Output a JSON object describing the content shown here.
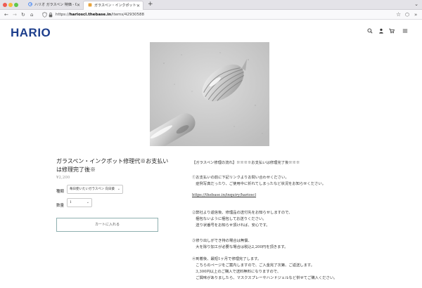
{
  "browser": {
    "tabs": [
      {
        "label": "ハリオ ガラスペン 特価 - Google",
        "active": false
      },
      {
        "label": "ガラスペン・インクポット修理代",
        "active": true
      }
    ],
    "new_tab_icon": "plus-icon",
    "url_host": "harioscl.thebase.in",
    "url_prefix": "https://",
    "url_path": "/items/42930588"
  },
  "site": {
    "logo": "HARIO",
    "brand_color": "#1d3e8c",
    "header_icons": [
      "search-icon",
      "user-icon",
      "cart-icon",
      "menu-icon"
    ]
  },
  "product": {
    "title": "ガラスペン・インクポット修理代※お支払いは修理完了後※",
    "price": "¥2,200",
    "options": [
      {
        "label": "種類",
        "value": "毎日使いたいガラスペン 向日葵"
      },
      {
        "label": "数量",
        "value": "1"
      }
    ],
    "cart_button": "カートに入れる"
  },
  "description": {
    "heading": "【ガラスペン修理の流れ】※※※※お支払いは修理完了後※※※",
    "step1": [
      "①お支払いの前に下記リンクよりお問い合わせください。",
      "　症例写真だったり、ご使用中に折れてしまったなど状況をお知らせください。"
    ],
    "link": "https://thebase.in/inquiry/harioscl",
    "step2": [
      "②弊社より返信後、修理品の送付先をお知らせしますので、",
      "　梱包ないように梱包してお送りください。",
      "　送り状番号をお知らせ頂ければ、安心です。"
    ],
    "step3": [
      "③修り出しができ持の場合は無償、",
      "　大を除り加工が必要な場合は税込2,200円を頂きます。"
    ],
    "step4": [
      "④到着後、最短1ヶ月で修理完了します。",
      "　こちらのページをご案内しますので、ご入金完了次第、ご返送します。",
      "　3,300円以上のご購入で送料無料になりますので、",
      "　ご興味がありましたら、マスクスプレーやハンドジェルなど併せてご購入ください。"
    ]
  }
}
